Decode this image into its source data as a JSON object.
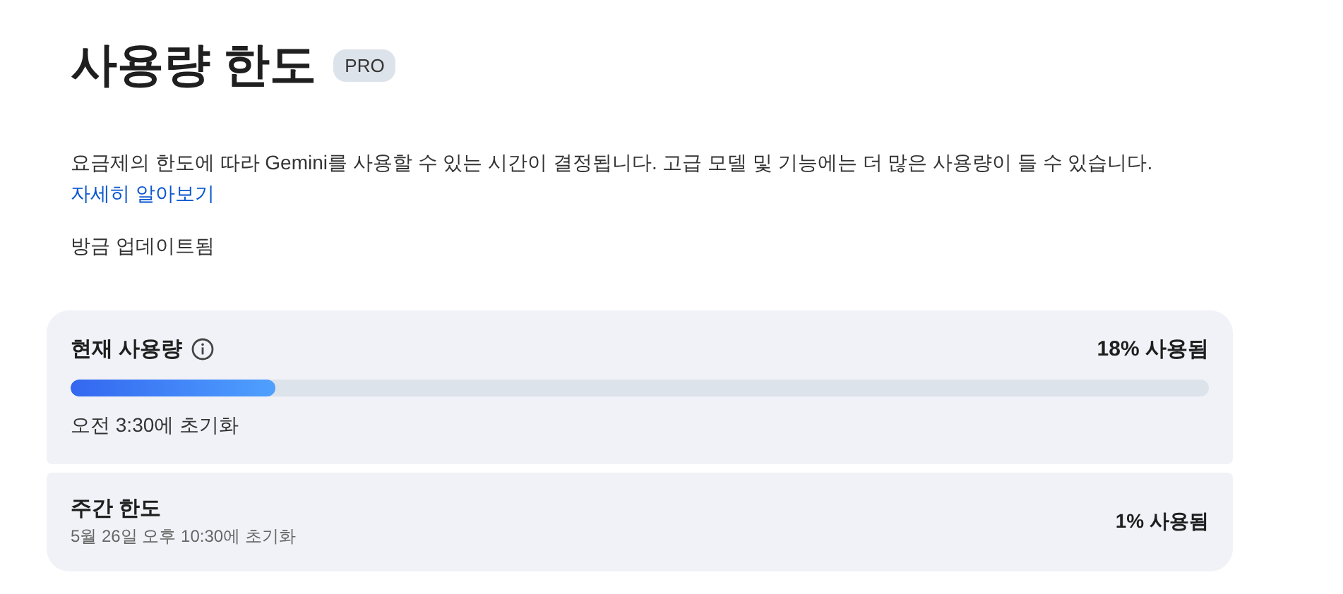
{
  "title": "사용량 한도",
  "badge": "PRO",
  "description": {
    "text": "요금제의 한도에 따라 Gemini를 사용할 수 있는 시간이 결정됩니다. 고급 모델 및 기능에는 더 많은 사용량이 들 수 있습니다.",
    "link": "자세히 알아보기"
  },
  "updated": "방금 업데이트됨",
  "limits": [
    {
      "kind": "meter",
      "label": "현재 사용량",
      "info": true,
      "used": "18% 사용됨",
      "level": 0.18,
      "reset": "오전 3:30에 초기화"
    },
    {
      "kind": "summary",
      "label": "주간 한도",
      "used": "1% 사용됨",
      "reset": "5월 26일 오후 10:30에 초기화"
    }
  ]
}
